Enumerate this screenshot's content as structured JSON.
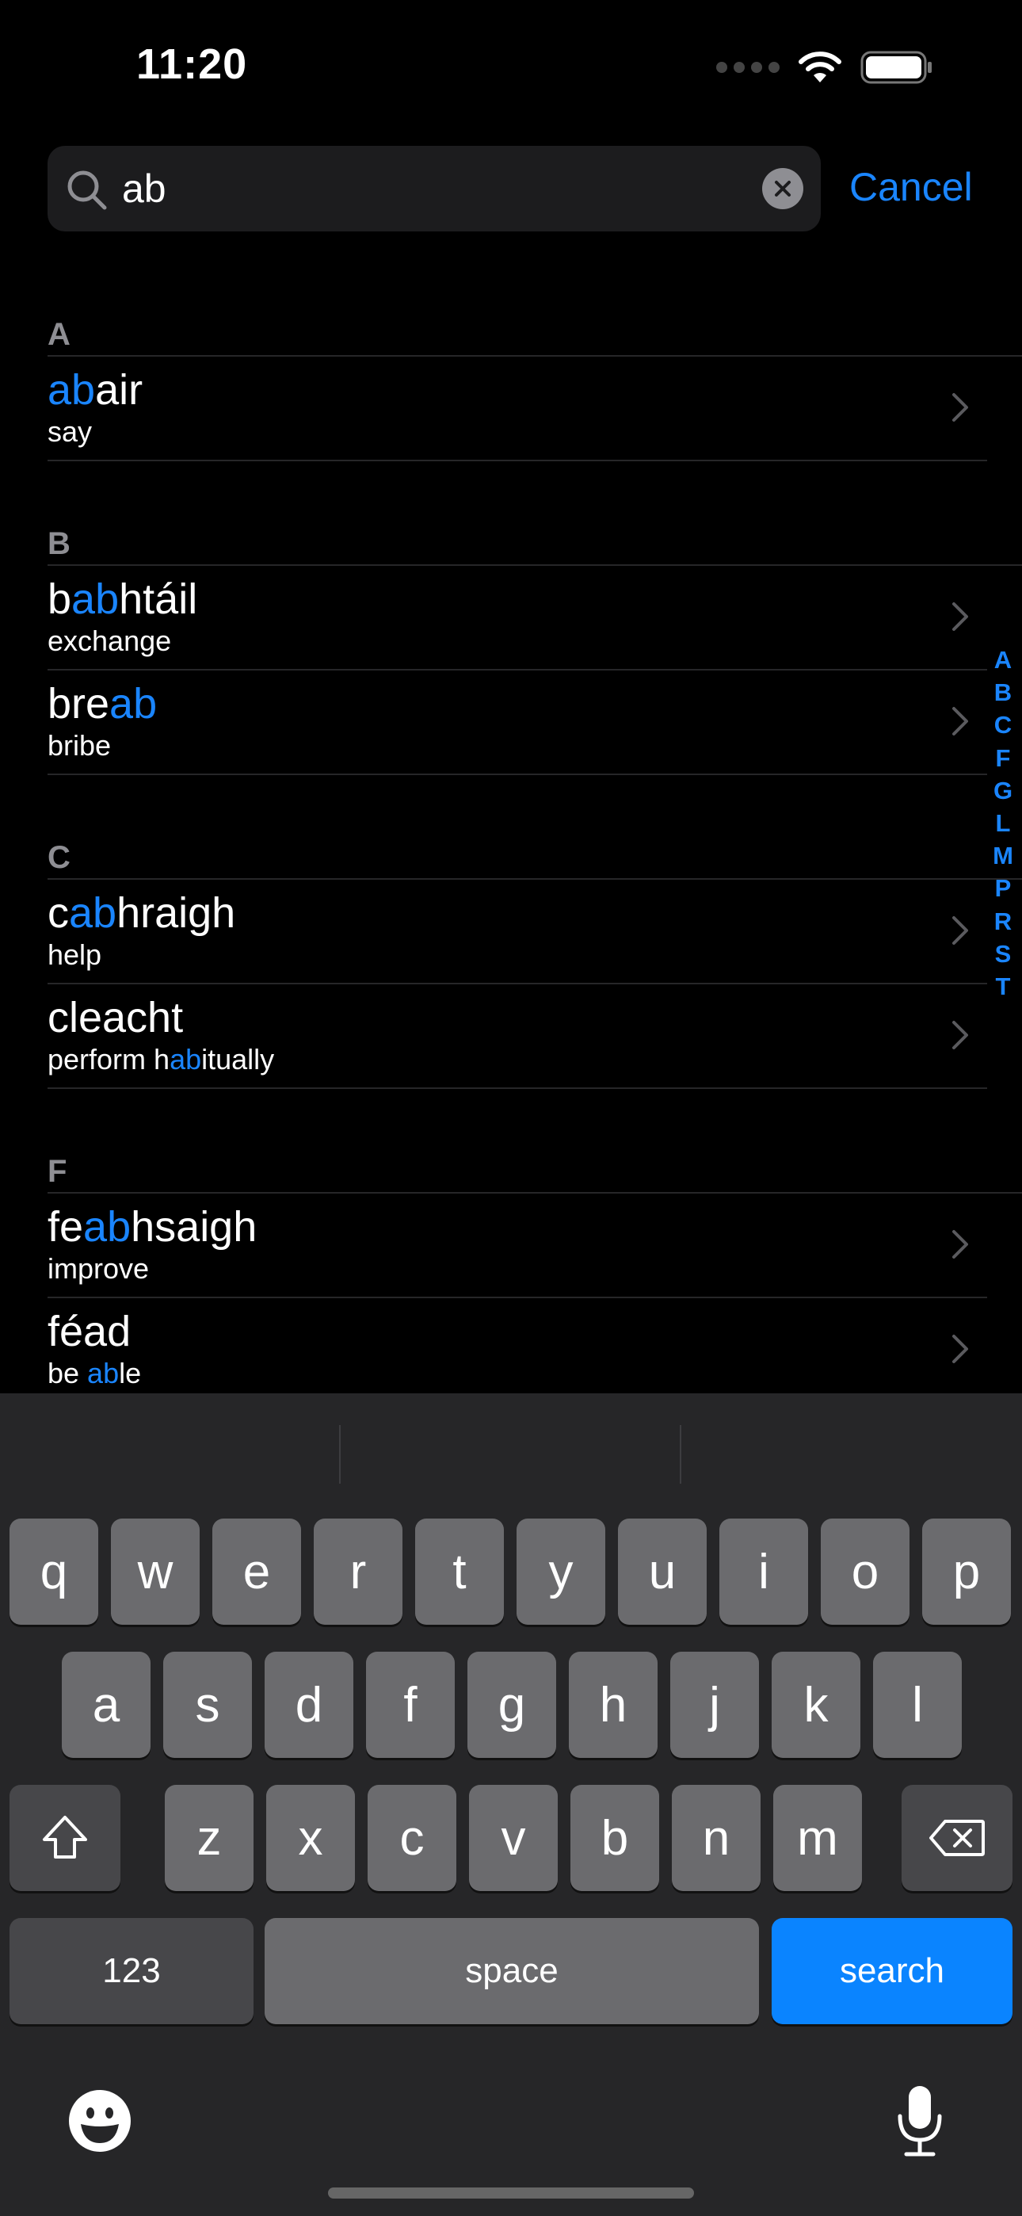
{
  "status": {
    "time": "11:20"
  },
  "search": {
    "query": "ab",
    "cancel_label": "Cancel"
  },
  "sections": [
    {
      "letter": "A",
      "rows": [
        {
          "title": [
            [
              "ab",
              true
            ],
            [
              "air",
              false
            ]
          ],
          "subtitle": [
            [
              "say",
              false
            ]
          ]
        }
      ]
    },
    {
      "letter": "B",
      "rows": [
        {
          "title": [
            [
              "b",
              false
            ],
            [
              "ab",
              true
            ],
            [
              "htáil",
              false
            ]
          ],
          "subtitle": [
            [
              "exchange",
              false
            ]
          ]
        },
        {
          "title": [
            [
              "bre",
              false
            ],
            [
              "ab",
              true
            ]
          ],
          "subtitle": [
            [
              "bribe",
              false
            ]
          ]
        }
      ]
    },
    {
      "letter": "C",
      "rows": [
        {
          "title": [
            [
              "c",
              false
            ],
            [
              "ab",
              true
            ],
            [
              "hraigh",
              false
            ]
          ],
          "subtitle": [
            [
              "help",
              false
            ]
          ]
        },
        {
          "title": [
            [
              "cleacht",
              false
            ]
          ],
          "subtitle": [
            [
              "perform h",
              false
            ],
            [
              "ab",
              true
            ],
            [
              "itually",
              false
            ]
          ]
        }
      ]
    },
    {
      "letter": "F",
      "rows": [
        {
          "title": [
            [
              "fe",
              false
            ],
            [
              "ab",
              true
            ],
            [
              "hsaigh",
              false
            ]
          ],
          "subtitle": [
            [
              "improve",
              false
            ]
          ]
        },
        {
          "title": [
            [
              "féad",
              false
            ]
          ],
          "subtitle": [
            [
              "be ",
              false
            ],
            [
              "ab",
              true
            ],
            [
              "le",
              false
            ]
          ]
        }
      ]
    }
  ],
  "index_letters": [
    "A",
    "B",
    "C",
    "F",
    "G",
    "L",
    "M",
    "P",
    "R",
    "S",
    "T"
  ],
  "keyboard": {
    "row1": [
      "q",
      "w",
      "e",
      "r",
      "t",
      "y",
      "u",
      "i",
      "o",
      "p"
    ],
    "row2": [
      "a",
      "s",
      "d",
      "f",
      "g",
      "h",
      "j",
      "k",
      "l"
    ],
    "row3": [
      "z",
      "x",
      "c",
      "v",
      "b",
      "n",
      "m"
    ],
    "numbers_label": "123",
    "space_label": "space",
    "search_label": "search"
  },
  "colors": {
    "accent": "#1a85ff",
    "search_key": "#0a84ff",
    "background": "#000000",
    "keyboard": "#262628"
  },
  "icons": [
    "search-icon",
    "clear-icon",
    "chevron-right-icon",
    "wifi-icon",
    "battery-icon",
    "shift-icon",
    "delete-icon",
    "emoji-icon",
    "microphone-icon"
  ]
}
